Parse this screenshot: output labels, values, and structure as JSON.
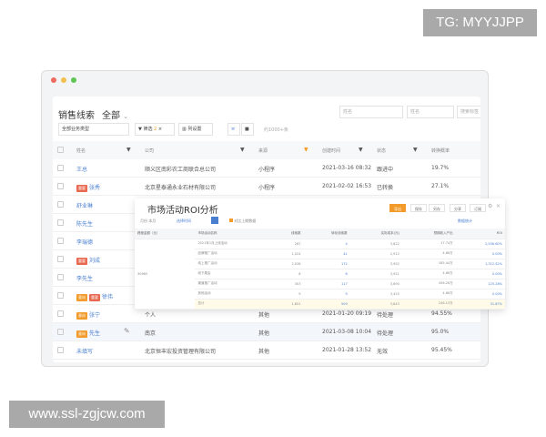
{
  "watermark_top": "TG: MYYJJPP",
  "watermark_bottom": "www.ssl-zgjcw.com",
  "window_dots": [
    "#ed6a5e",
    "#f5bf4f",
    "#61c554"
  ],
  "page": {
    "title": "销售线索",
    "view": "全部",
    "business_type": "全部业务类型",
    "filter_label": "筛选",
    "filter_count": "2",
    "column_settings": "列设置",
    "total": "约1000+条",
    "search1_placeholder": "姓名",
    "search2_placeholder": "姓名",
    "search3_placeholder": "搜索标签"
  },
  "columns": [
    "姓名",
    "公司",
    "来源",
    "创建时间",
    "状态",
    "转换概率"
  ],
  "rows": [
    {
      "name": "王总",
      "tags": [],
      "company": "顺义区南彩农工商联合总公司",
      "source": "小程序",
      "created": "2021-03-16 08:32",
      "status": "跟进中",
      "rate": "19.7%"
    },
    {
      "name": "张秀",
      "tags": [
        {
          "label": "重要",
          "color": "r"
        }
      ],
      "company": "北京星泰通永业石材有限公司",
      "source": "小程序",
      "created": "2021-02-02 16:53",
      "status": "已转换",
      "rate": "27.1%"
    },
    {
      "name": "舒业琳",
      "tags": [],
      "company": "",
      "source": "",
      "created": "",
      "status": "",
      "rate": ""
    },
    {
      "name": "陈先生",
      "tags": [],
      "company": "",
      "source": "",
      "created": "",
      "status": "",
      "rate": ""
    },
    {
      "name": "李瑞德",
      "tags": [],
      "company": "",
      "source": "",
      "created": "",
      "status": "",
      "rate": ""
    },
    {
      "name": "刘成",
      "tags": [
        {
          "label": "重要",
          "color": "r"
        }
      ],
      "company": "",
      "source": "",
      "created": "",
      "status": "",
      "rate": ""
    },
    {
      "name": "李先生",
      "tags": [],
      "company": "",
      "source": "",
      "created": "",
      "status": "",
      "rate": ""
    },
    {
      "name": "徐伟",
      "tags": [
        {
          "label": "意向",
          "color": "o"
        },
        {
          "label": "重要",
          "color": "r"
        }
      ],
      "company": "",
      "source": "",
      "created": "",
      "status": "",
      "rate": ""
    },
    {
      "name": "张宁",
      "tags": [
        {
          "label": "意向",
          "color": "o"
        }
      ],
      "company": "个人",
      "source": "其他",
      "created": "2021-01-20 09:19",
      "status": "待处理",
      "rate": "94.55%"
    },
    {
      "name": "先生",
      "tags": [
        {
          "label": "意向",
          "color": "o"
        }
      ],
      "company": "南京",
      "source": "其他",
      "created": "2021-03-08 10:04",
      "status": "待处理",
      "rate": "95.0%"
    },
    {
      "name": "未填写",
      "tags": [],
      "company": "北京恒丰宏投资管理有限公司",
      "source": "其他",
      "created": "2021-01-28 13:52",
      "status": "无效",
      "rate": "95.45%"
    }
  ],
  "roi": {
    "title": "市场活动ROI分析",
    "buttons": [
      "导出",
      "保存",
      "另存",
      "分享",
      "订阅"
    ],
    "toolbar_left": "月份 本月",
    "toolbar_link": "选择时间",
    "note": "对比上期数据",
    "toolbar_right": "数据统计",
    "headers": [
      "跨度金额（元）",
      "市场活动名称",
      "线索数",
      "转化线索数",
      "实际成本(元)",
      "预期收入产出",
      "ROI"
    ],
    "group": "30965",
    "rows": [
      [
        "2021年1月上线活动",
        "267",
        "4",
        "3,822",
        "17.74万",
        "2,556.60%"
      ],
      [
        "品牌推广活动",
        "1,024",
        "41",
        "2,912",
        "4.66万",
        "0.00%"
      ],
      [
        "线上推广活动",
        "2,036",
        "172",
        "3,952",
        "185.44万",
        "1,312.52%"
      ],
      [
        "线下展会",
        "8",
        "6",
        "3,921",
        "4.66万",
        "0.00%"
      ],
      [
        "渠道推广活动",
        "303",
        "117",
        "3,690",
        "456.26万",
        "125.28%"
      ],
      [
        "其他活动",
        "9",
        "9",
        "3,425",
        "4.66万",
        "0.00%"
      ],
      [
        "总计",
        "1,651",
        "509",
        "3,843",
        "246.13万",
        "31.87%"
      ]
    ]
  }
}
